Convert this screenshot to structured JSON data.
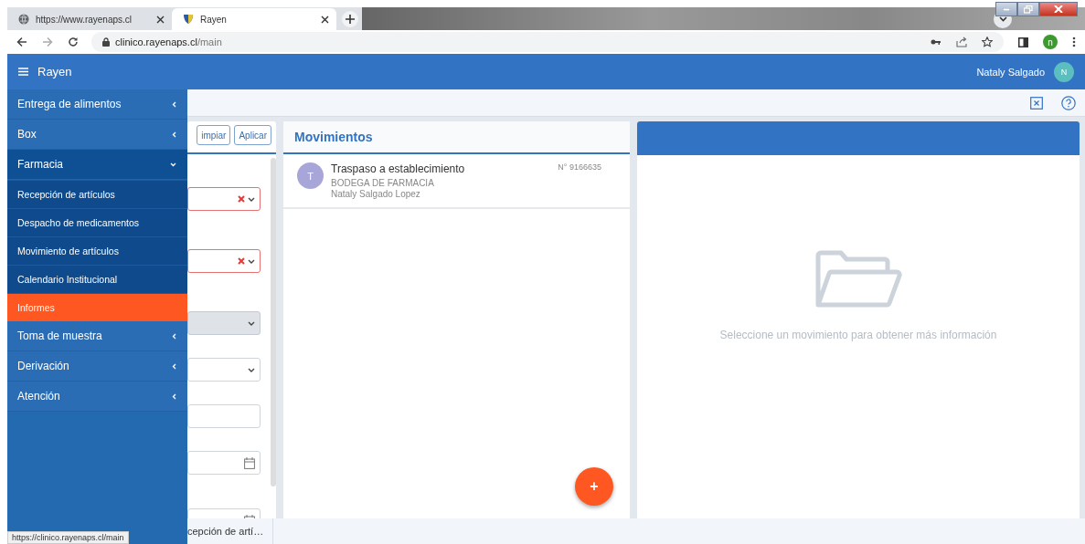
{
  "browser": {
    "tabs": [
      {
        "title": "https://www.rayenaps.cl",
        "selected": false
      },
      {
        "title": "Rayen",
        "selected": true
      }
    ],
    "address": {
      "host": "clinico.rayenaps.cl",
      "path": "/main"
    },
    "profile_initial": "n"
  },
  "app": {
    "title": "Rayen",
    "user": "Nataly Salgado",
    "user_initial": "N"
  },
  "sidebar": {
    "items": [
      {
        "kind": "group",
        "label": "Entrega de alimentos",
        "expanded": false
      },
      {
        "kind": "group",
        "label": "Box",
        "expanded": false
      },
      {
        "kind": "group",
        "label": "Farmacia",
        "expanded": true,
        "children": [
          {
            "label": "Recepción de artículos",
            "selected": false
          },
          {
            "label": "Despacho de medicamentos",
            "selected": false
          },
          {
            "label": "Movimiento de artículos",
            "selected": false
          },
          {
            "label": "Calendario Institucional",
            "selected": false
          },
          {
            "label": "Informes",
            "selected": true
          }
        ]
      },
      {
        "kind": "group",
        "label": "Toma de muestra",
        "expanded": false
      },
      {
        "kind": "group",
        "label": "Derivación",
        "expanded": false
      },
      {
        "kind": "group",
        "label": "Atención",
        "expanded": false
      }
    ]
  },
  "filters": {
    "buttons": [
      "impiar",
      "Aplicar"
    ],
    "fields": [
      {
        "kind": "select",
        "invalid": true,
        "disabled": false
      },
      {
        "kind": "select",
        "invalid": true,
        "disabled": false
      },
      {
        "kind": "select",
        "invalid": false,
        "disabled": true
      },
      {
        "kind": "select",
        "invalid": false,
        "disabled": false
      },
      {
        "kind": "text",
        "invalid": false,
        "disabled": false
      },
      {
        "kind": "date",
        "invalid": false,
        "disabled": false
      },
      {
        "kind": "date",
        "invalid": false,
        "disabled": false
      }
    ]
  },
  "movements": {
    "title": "Movimientos",
    "items": [
      {
        "initial": "T",
        "title": "Traspaso a establecimiento",
        "subtitle": "BODEGA DE FARMACIA",
        "user": "Nataly Salgado Lopez",
        "number": "N° 9166635"
      }
    ],
    "add_button": "+"
  },
  "detail": {
    "empty_message": "Seleccione un movimiento para obtener más información"
  },
  "bottom_tabs": [
    "cepción de artí…"
  ],
  "status_url": "https://clinico.rayenaps.cl/main"
}
